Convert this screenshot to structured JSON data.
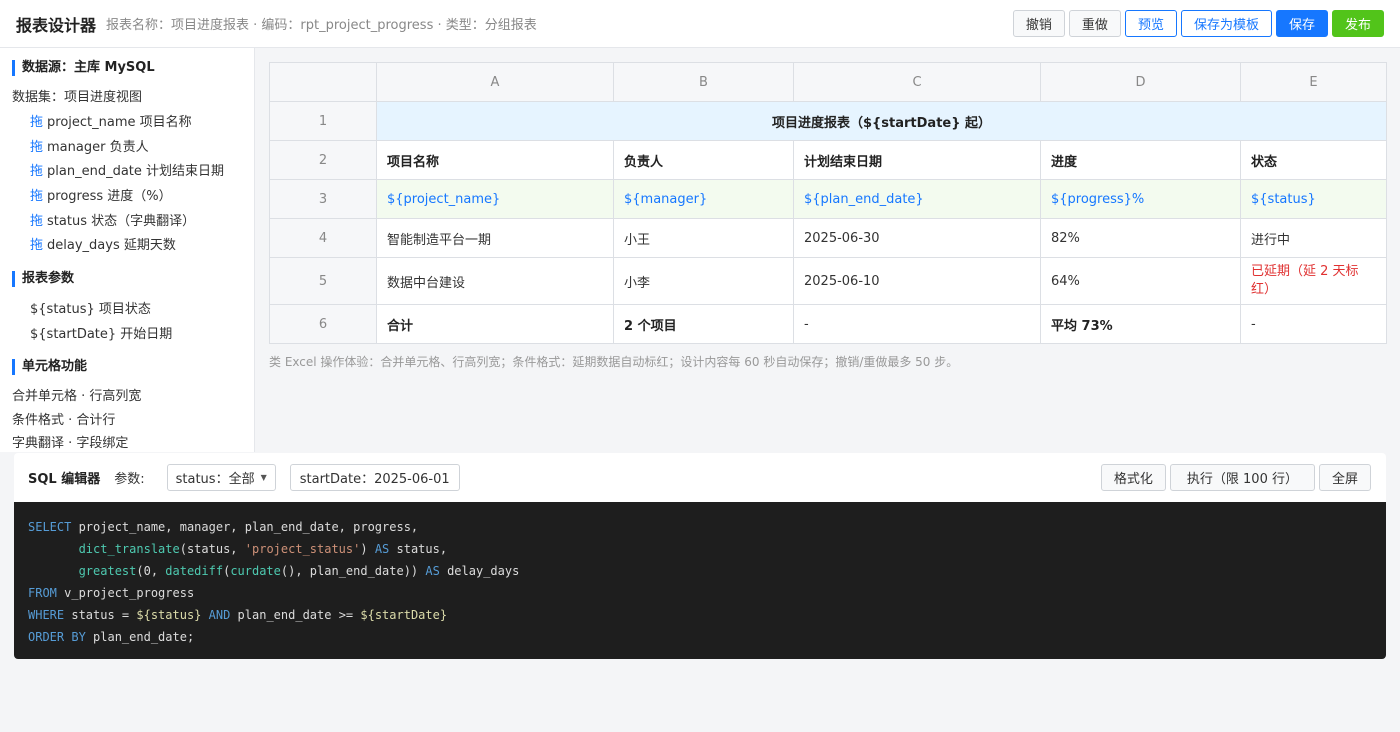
{
  "header": {
    "app_title": "报表设计器",
    "report_meta": "报表名称：项目进度报表 · 编码：rpt_project_progress · 类型：分组报表",
    "buttons": {
      "undo": "撤销",
      "redo": "重做",
      "preview": "预览",
      "save_template": "保存为模板",
      "save": "保存",
      "publish": "发布"
    }
  },
  "sidebar": {
    "datasource_title": "数据源：主库 MySQL",
    "dataset_label": "数据集：项目进度视图",
    "drag_mark": "拖",
    "fields": [
      "project_name 项目名称",
      "manager 负责人",
      "plan_end_date 计划结束日期",
      "progress 进度（%）",
      "status 状态（字典翻译）",
      "delay_days 延期天数"
    ],
    "params_title": "报表参数",
    "params": [
      "${status} 项目状态",
      "${startDate} 开始日期"
    ],
    "features_title": "单元格功能",
    "features": [
      "合并单元格 · 行高列宽",
      "条件格式 · 合计行",
      "字典翻译 · 字段绑定"
    ]
  },
  "sheet": {
    "columns": [
      "A",
      "B",
      "C",
      "D",
      "E"
    ],
    "rows": [
      "1",
      "2",
      "3",
      "4",
      "5",
      "6"
    ],
    "title": "项目进度报表（${startDate} 起）",
    "headers": [
      "项目名称",
      "负责人",
      "计划结束日期",
      "进度",
      "状态"
    ],
    "bindings": [
      "${project_name}",
      "${manager}",
      "${plan_end_date}",
      "${progress}%",
      "${status}"
    ],
    "data_rows": [
      [
        "智能制造平台一期",
        "小王",
        "2025-06-30",
        "82%",
        "进行中"
      ],
      [
        "数据中台建设",
        "小李",
        "2025-06-10",
        "64%",
        "已延期（延 2 天标红）"
      ]
    ],
    "total_row": [
      "合计",
      "2 个项目",
      "-",
      "平均 73%",
      "-"
    ],
    "delay_color": "#e03131",
    "hint": "类 Excel 操作体验：合并单元格、行高列宽；条件格式：延期数据自动标红；设计内容每 60 秒自动保存；撤销/重做最多 50 步。"
  },
  "sql_editor": {
    "title": "SQL 编辑器",
    "params_label": "参数:",
    "status_select": "status：全部",
    "start_date_field": "startDate：2025-06-01",
    "buttons": {
      "format": "格式化",
      "execute": "执行（限 100 行）",
      "fullscreen": "全屏"
    },
    "code_lines": [
      "SELECT project_name, manager, plan_end_date, progress,",
      "       dict_translate(status, 'project_status') AS status,",
      "       greatest(0, datediff(curdate(), plan_end_date)) AS delay_days",
      "FROM v_project_progress",
      "WHERE status = ${status} AND plan_end_date >= ${startDate}",
      "ORDER BY plan_end_date;"
    ]
  },
  "colors": {
    "primary": "#1677ff",
    "success": "#52c41a",
    "title_cell_bg": "#e6f4ff",
    "binding_row_bg": "#f3fbef",
    "code_bg": "#1e1e1e"
  }
}
